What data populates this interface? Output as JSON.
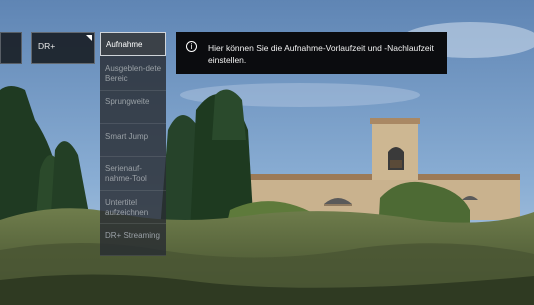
{
  "top_tabs": {
    "prev_label": "",
    "channel_label": "DR+"
  },
  "menu": {
    "items": [
      {
        "label": "Aufnahme",
        "active": true
      },
      {
        "label": "Ausgeblen-dete Bereic",
        "active": false
      },
      {
        "label": "Sprungweite",
        "active": false
      },
      {
        "label": "Smart Jump",
        "active": false
      },
      {
        "label": "Serienauf-nahme-Tool",
        "active": false
      },
      {
        "label": "Untertitel aufzeichnen",
        "active": false
      },
      {
        "label": "DR+ Streaming",
        "active": false
      }
    ]
  },
  "tooltip": {
    "icon": "info-icon",
    "text": "Hier können Sie die Aufnahme-Vorlaufzeit und -Nachlaufzeit einstellen."
  },
  "colors": {
    "sky": "#6d8fb8",
    "menu_bg": "#282c32",
    "tooltip_bg": "#0b0c0f"
  }
}
